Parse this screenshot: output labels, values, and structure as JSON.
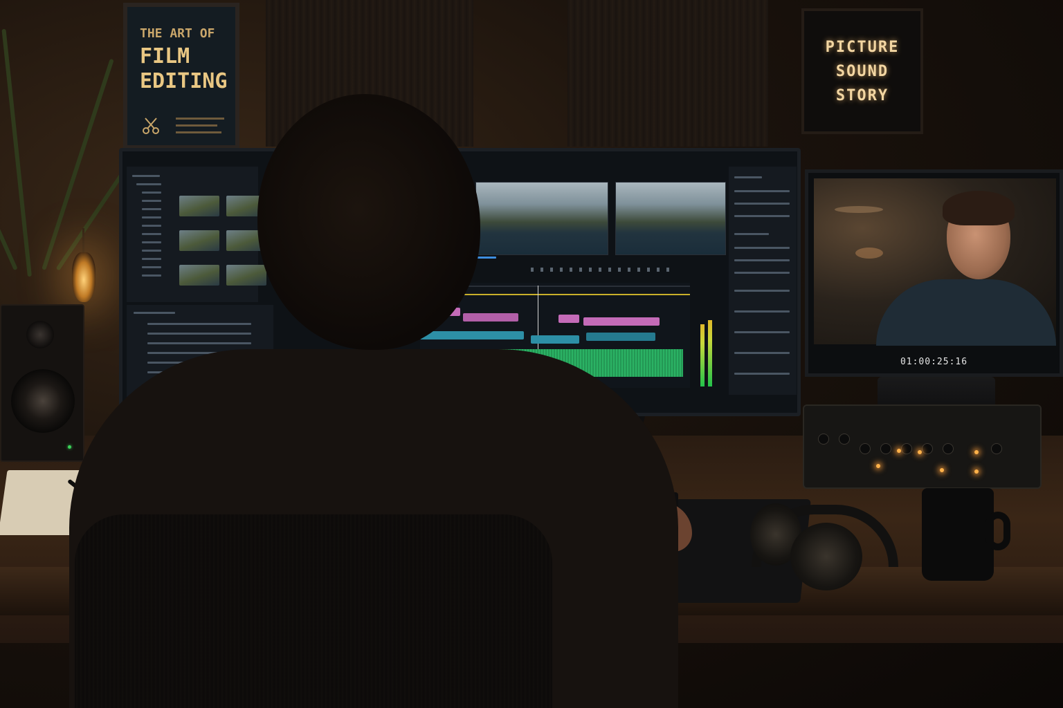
{
  "poster": {
    "line1": "THE ART OF",
    "line2": "FILM",
    "line3": "EDITING",
    "icon": "scissors-icon"
  },
  "sign": {
    "line1": "PICTURE",
    "line2": "SOUND",
    "line3": "STORY"
  },
  "right_monitor": {
    "timecode": "01:00:25:16"
  },
  "colors": {
    "timeline_pink": "#c46bb8",
    "timeline_teal": "#2d8fa6",
    "audio_green": "#2fbf6b",
    "meter_green": "#22c24a",
    "lamp_glow": "#ffb24a",
    "sign_text": "#f3d6a2"
  }
}
